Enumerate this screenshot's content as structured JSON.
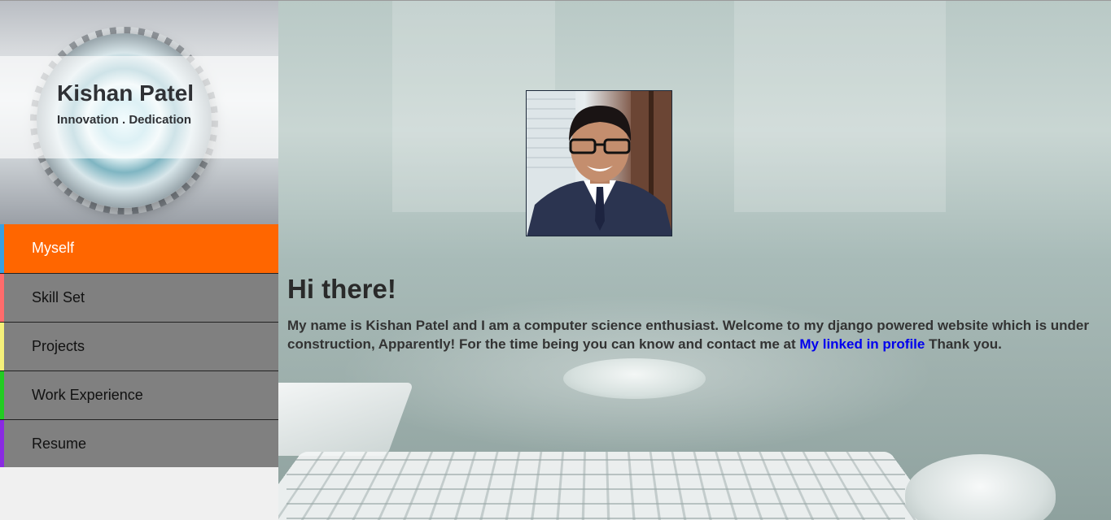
{
  "profile": {
    "name": "Kishan Patel",
    "tagline": "Innovation . Dedication"
  },
  "nav": {
    "items": [
      {
        "label": "Myself",
        "accent": "#3aa0e0",
        "active": true
      },
      {
        "label": "Skill Set",
        "accent": "#ff6b6b",
        "active": false
      },
      {
        "label": "Projects",
        "accent": "#f5f07a",
        "active": false
      },
      {
        "label": "Work Experience",
        "accent": "#22cc22",
        "active": false
      },
      {
        "label": "Resume",
        "accent": "#8a2be2",
        "active": false
      }
    ]
  },
  "main": {
    "greeting": "Hi there!",
    "intro_before": "My name is Kishan Patel and I am a computer science enthusiast. Welcome to my django powered website which is under construction, Apparently! For the time being you can know and contact me at ",
    "link_label": "My linked in profile",
    "intro_after": " Thank you."
  },
  "colors": {
    "active_nav_bg": "#ff6600",
    "nav_bg": "#808080",
    "link": "#0000ee"
  }
}
